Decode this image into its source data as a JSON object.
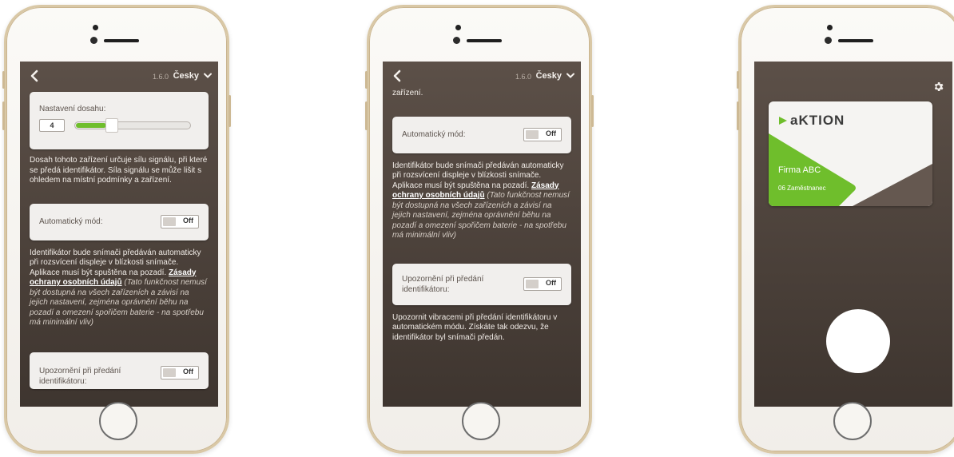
{
  "screen1": {
    "version": "1.6.0",
    "language": "Česky",
    "range": {
      "label": "Nastavení dosahu:",
      "value": "4",
      "level_fraction": 0.3
    },
    "range_description": "Dosah tohoto zařízení určuje sílu signálu, při které se předá identifikátor. Síla signálu se může lišit s ohledem na místní podmínky a zařízení.",
    "auto_mode": {
      "label": "Automatický mód:",
      "toggle": "Off"
    },
    "auto_desc_main": "Identifikátor bude snímači předáván automaticky při rozsvícení displeje v blízkosti snímače. Aplikace musí být spuštěna na pozadí.",
    "privacy_link": "Zásady ochrany osobních údajů",
    "auto_desc_note": "(Tato funkčnost nemusí být dostupná na všech zařízeních a závisí na jejich nastavení, zejména oprávnění běhu na pozadí a omezení spořičem baterie - na spotřebu má minimální vliv)",
    "notify": {
      "label": "Upozornění při předání identifikátoru:",
      "toggle": "Off"
    }
  },
  "screen2": {
    "version": "1.6.0",
    "language": "Česky",
    "top_fragment": "zařízení.",
    "auto_mode": {
      "label": "Automatický mód:",
      "toggle": "Off"
    },
    "auto_desc_main": "Identifikátor bude snímači předáván automaticky při rozsvícení displeje v blízkosti snímače. Aplikace musí být spuštěna na pozadí.",
    "privacy_link": "Zásady ochrany osobních údajů",
    "auto_desc_note": "(Tato funkčnost nemusí být dostupná na všech zařízeních a závisí na jejich nastavení, zejména oprávnění běhu na pozadí a omezení spořičem baterie - na spotřebu má minimální vliv)",
    "notify": {
      "label": "Upozornění při předání identifikátoru:",
      "toggle": "Off"
    },
    "notify_desc": "Upozornit vibracemi při předání identifikátoru v automatickém módu. Získáte tak odezvu, že identifikátor byl snímači předán."
  },
  "screen3": {
    "brand": "aKTION",
    "company": "Firma ABC",
    "role": "06 Zaměstnanec"
  },
  "colors": {
    "screen_top": "#5c5048",
    "screen_bottom": "#3e352f",
    "accent_green": "#6fbe2c",
    "card": "#f1efed",
    "phone_frame": "#d9c8a6"
  },
  "icons": [
    "back-chevron-icon",
    "dropdown-chevron-icon",
    "gear-icon",
    "home-button"
  ]
}
